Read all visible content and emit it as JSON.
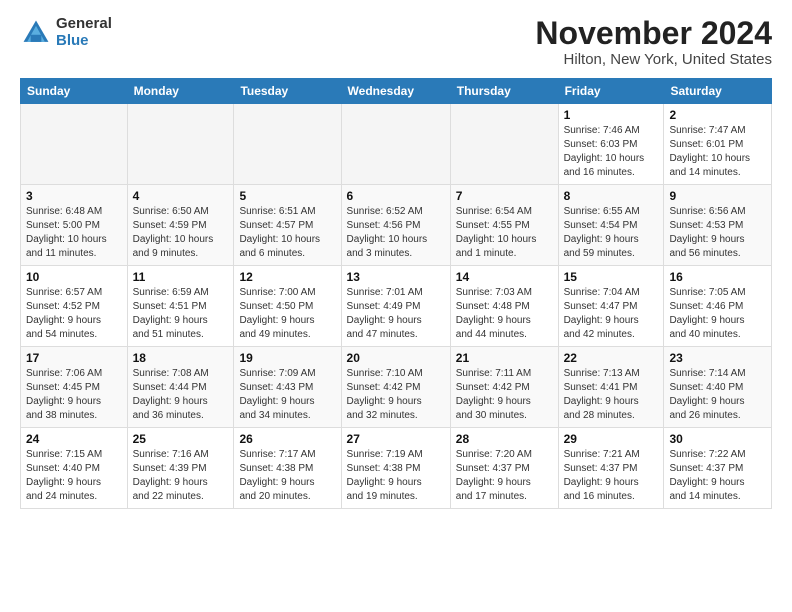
{
  "logo": {
    "general": "General",
    "blue": "Blue"
  },
  "title": "November 2024",
  "subtitle": "Hilton, New York, United States",
  "days_of_week": [
    "Sunday",
    "Monday",
    "Tuesday",
    "Wednesday",
    "Thursday",
    "Friday",
    "Saturday"
  ],
  "weeks": [
    [
      {
        "day": "",
        "info": ""
      },
      {
        "day": "",
        "info": ""
      },
      {
        "day": "",
        "info": ""
      },
      {
        "day": "",
        "info": ""
      },
      {
        "day": "",
        "info": ""
      },
      {
        "day": "1",
        "info": "Sunrise: 7:46 AM\nSunset: 6:03 PM\nDaylight: 10 hours\nand 16 minutes."
      },
      {
        "day": "2",
        "info": "Sunrise: 7:47 AM\nSunset: 6:01 PM\nDaylight: 10 hours\nand 14 minutes."
      }
    ],
    [
      {
        "day": "3",
        "info": "Sunrise: 6:48 AM\nSunset: 5:00 PM\nDaylight: 10 hours\nand 11 minutes."
      },
      {
        "day": "4",
        "info": "Sunrise: 6:50 AM\nSunset: 4:59 PM\nDaylight: 10 hours\nand 9 minutes."
      },
      {
        "day": "5",
        "info": "Sunrise: 6:51 AM\nSunset: 4:57 PM\nDaylight: 10 hours\nand 6 minutes."
      },
      {
        "day": "6",
        "info": "Sunrise: 6:52 AM\nSunset: 4:56 PM\nDaylight: 10 hours\nand 3 minutes."
      },
      {
        "day": "7",
        "info": "Sunrise: 6:54 AM\nSunset: 4:55 PM\nDaylight: 10 hours\nand 1 minute."
      },
      {
        "day": "8",
        "info": "Sunrise: 6:55 AM\nSunset: 4:54 PM\nDaylight: 9 hours\nand 59 minutes."
      },
      {
        "day": "9",
        "info": "Sunrise: 6:56 AM\nSunset: 4:53 PM\nDaylight: 9 hours\nand 56 minutes."
      }
    ],
    [
      {
        "day": "10",
        "info": "Sunrise: 6:57 AM\nSunset: 4:52 PM\nDaylight: 9 hours\nand 54 minutes."
      },
      {
        "day": "11",
        "info": "Sunrise: 6:59 AM\nSunset: 4:51 PM\nDaylight: 9 hours\nand 51 minutes."
      },
      {
        "day": "12",
        "info": "Sunrise: 7:00 AM\nSunset: 4:50 PM\nDaylight: 9 hours\nand 49 minutes."
      },
      {
        "day": "13",
        "info": "Sunrise: 7:01 AM\nSunset: 4:49 PM\nDaylight: 9 hours\nand 47 minutes."
      },
      {
        "day": "14",
        "info": "Sunrise: 7:03 AM\nSunset: 4:48 PM\nDaylight: 9 hours\nand 44 minutes."
      },
      {
        "day": "15",
        "info": "Sunrise: 7:04 AM\nSunset: 4:47 PM\nDaylight: 9 hours\nand 42 minutes."
      },
      {
        "day": "16",
        "info": "Sunrise: 7:05 AM\nSunset: 4:46 PM\nDaylight: 9 hours\nand 40 minutes."
      }
    ],
    [
      {
        "day": "17",
        "info": "Sunrise: 7:06 AM\nSunset: 4:45 PM\nDaylight: 9 hours\nand 38 minutes."
      },
      {
        "day": "18",
        "info": "Sunrise: 7:08 AM\nSunset: 4:44 PM\nDaylight: 9 hours\nand 36 minutes."
      },
      {
        "day": "19",
        "info": "Sunrise: 7:09 AM\nSunset: 4:43 PM\nDaylight: 9 hours\nand 34 minutes."
      },
      {
        "day": "20",
        "info": "Sunrise: 7:10 AM\nSunset: 4:42 PM\nDaylight: 9 hours\nand 32 minutes."
      },
      {
        "day": "21",
        "info": "Sunrise: 7:11 AM\nSunset: 4:42 PM\nDaylight: 9 hours\nand 30 minutes."
      },
      {
        "day": "22",
        "info": "Sunrise: 7:13 AM\nSunset: 4:41 PM\nDaylight: 9 hours\nand 28 minutes."
      },
      {
        "day": "23",
        "info": "Sunrise: 7:14 AM\nSunset: 4:40 PM\nDaylight: 9 hours\nand 26 minutes."
      }
    ],
    [
      {
        "day": "24",
        "info": "Sunrise: 7:15 AM\nSunset: 4:40 PM\nDaylight: 9 hours\nand 24 minutes."
      },
      {
        "day": "25",
        "info": "Sunrise: 7:16 AM\nSunset: 4:39 PM\nDaylight: 9 hours\nand 22 minutes."
      },
      {
        "day": "26",
        "info": "Sunrise: 7:17 AM\nSunset: 4:38 PM\nDaylight: 9 hours\nand 20 minutes."
      },
      {
        "day": "27",
        "info": "Sunrise: 7:19 AM\nSunset: 4:38 PM\nDaylight: 9 hours\nand 19 minutes."
      },
      {
        "day": "28",
        "info": "Sunrise: 7:20 AM\nSunset: 4:37 PM\nDaylight: 9 hours\nand 17 minutes."
      },
      {
        "day": "29",
        "info": "Sunrise: 7:21 AM\nSunset: 4:37 PM\nDaylight: 9 hours\nand 16 minutes."
      },
      {
        "day": "30",
        "info": "Sunrise: 7:22 AM\nSunset: 4:37 PM\nDaylight: 9 hours\nand 14 minutes."
      }
    ]
  ]
}
